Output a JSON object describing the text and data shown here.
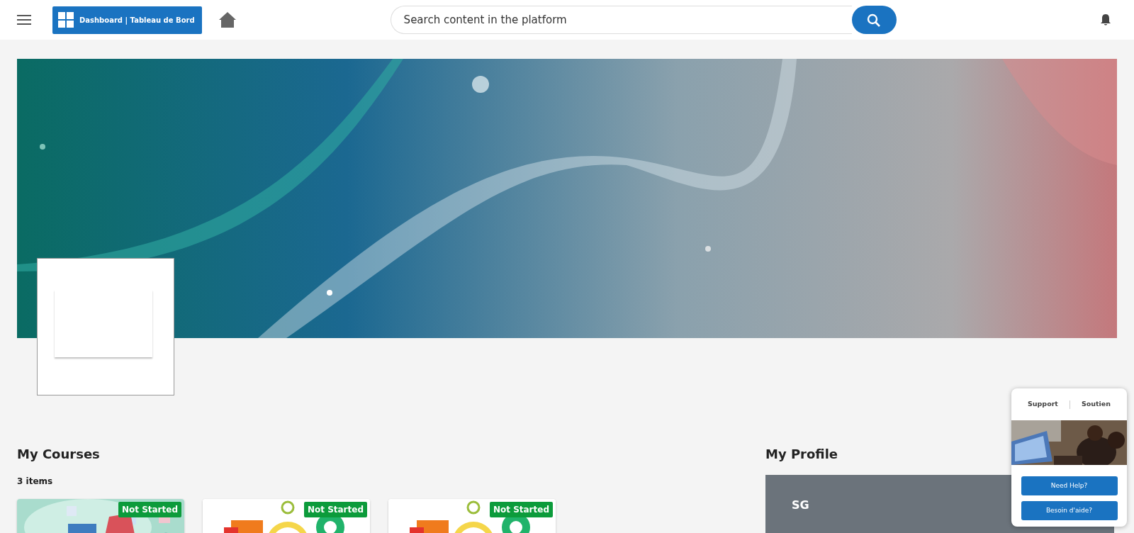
{
  "header": {
    "brand": "Dashboard | Tableau de Bord",
    "search": {
      "placeholder": "Search content in the platform"
    }
  },
  "courses": {
    "title": "My Courses",
    "count": "3 items",
    "items": [
      {
        "status": "Not Started"
      },
      {
        "status": "Not Started"
      },
      {
        "status": "Not Started"
      }
    ]
  },
  "profile": {
    "title": "My Profile",
    "initials": "SG"
  },
  "support_widget": {
    "tabs": [
      "Support",
      "Soutien"
    ],
    "buttons": [
      "Need Help?",
      "Besoin d'aide?"
    ]
  }
}
